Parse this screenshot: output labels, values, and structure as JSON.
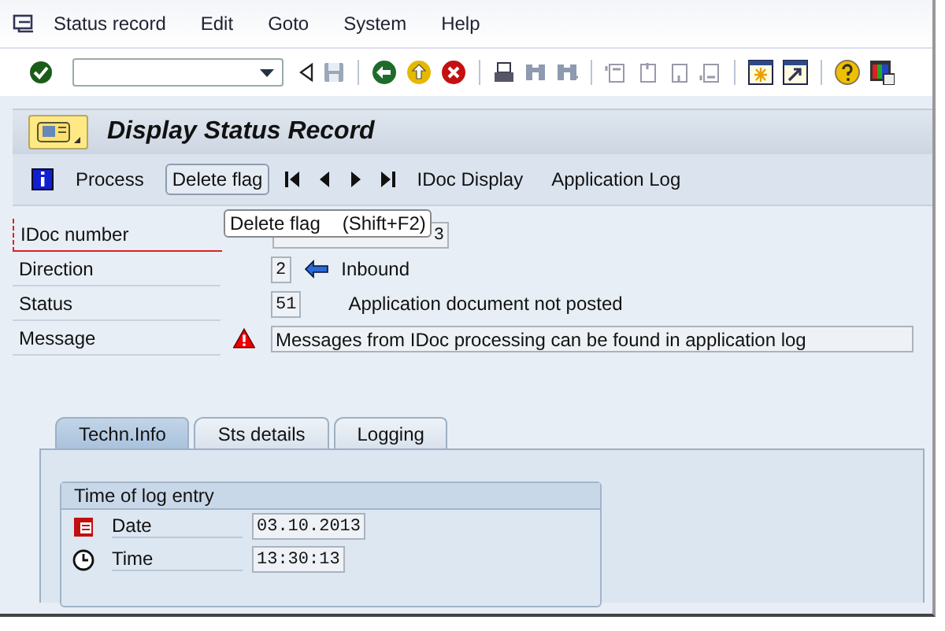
{
  "menu": [
    "Status record",
    "Edit",
    "Goto",
    "System",
    "Help"
  ],
  "title": "Display Status Record",
  "app_toolbar": [
    {
      "kind": "info"
    },
    {
      "kind": "text",
      "label": "Process"
    },
    {
      "kind": "button",
      "label": "Delete flag"
    },
    {
      "kind": "first"
    },
    {
      "kind": "prev"
    },
    {
      "kind": "next"
    },
    {
      "kind": "last"
    },
    {
      "kind": "text",
      "label": "IDoc Display"
    },
    {
      "kind": "text",
      "label": "Application Log"
    }
  ],
  "tooltip": {
    "text": "Delete flag",
    "shortcut": "(Shift+F2)"
  },
  "fields": [
    {
      "kind": "number",
      "label": "IDoc number",
      "value": "3",
      "focused": true
    },
    {
      "kind": "direction",
      "label": "Direction",
      "value": "2",
      "description": "Inbound",
      "focused": false
    },
    {
      "kind": "status",
      "label": "Status",
      "value": "51",
      "description": "Application document not posted",
      "focused": false
    },
    {
      "kind": "message",
      "label": "Message",
      "value": "Messages from IDoc processing can be found in application log",
      "focused": false
    }
  ],
  "tabs": [
    {
      "label": "Techn.Info",
      "selected": true
    },
    {
      "label": "Sts details",
      "selected": false
    },
    {
      "label": "Logging",
      "selected": false
    }
  ],
  "group": {
    "title": "Time of log entry",
    "rows": [
      {
        "kind": "date",
        "label": "Date",
        "value": "03.10.2013"
      },
      {
        "kind": "time",
        "label": "Time",
        "value": "13:30:13"
      }
    ]
  }
}
